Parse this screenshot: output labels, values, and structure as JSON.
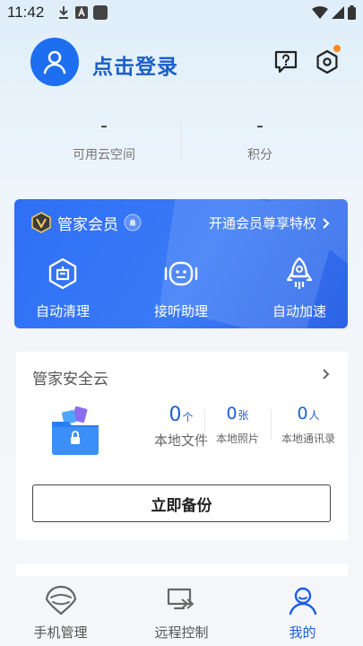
{
  "status_bar": {
    "time": "11:42"
  },
  "header": {
    "login_label": "点击登录"
  },
  "stats": [
    {
      "value": "-",
      "label": "可用云空间"
    },
    {
      "value": "-",
      "label": "积分"
    }
  ],
  "vip": {
    "title": "管家会员",
    "promo": "开通会员尊享特权",
    "features": [
      {
        "label": "自动清理",
        "icon": "broom-cleanup-icon"
      },
      {
        "label": "接听助理",
        "icon": "robot-assistant-icon"
      },
      {
        "label": "自动加速",
        "icon": "rocket-icon"
      }
    ]
  },
  "cloud": {
    "title": "管家安全云",
    "stats": [
      {
        "value": "0",
        "unit": "个",
        "label": "本地文件"
      },
      {
        "value": "0",
        "unit": "张",
        "label": "本地照片"
      },
      {
        "value": "0",
        "unit": "人",
        "label": "本地通讯录"
      }
    ],
    "backup_label": "立即备份"
  },
  "tabs": [
    {
      "label": "手机管理",
      "icon": "shield-helmet-icon",
      "active": false
    },
    {
      "label": "远程控制",
      "icon": "remote-screen-icon",
      "active": false
    },
    {
      "label": "我的",
      "icon": "user-icon",
      "active": true
    }
  ],
  "colors": {
    "accent": "#1d6ff0",
    "vip_card": "#3a7af7",
    "notification_dot": "#ff8a1c"
  }
}
